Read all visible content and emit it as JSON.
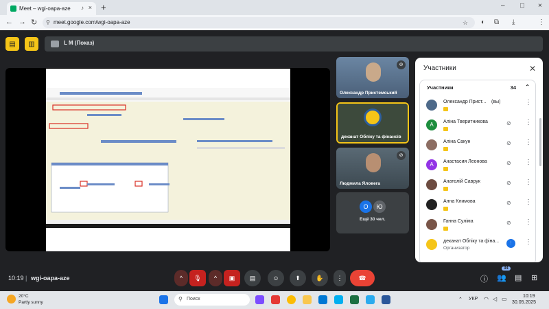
{
  "browser": {
    "tab_title": "Meet – wgi-oapa-aze",
    "url": "meet.google.com/wgi-oapa-aze",
    "new_tab": "+",
    "tab_close": "×",
    "win_min": "–",
    "win_max": "□",
    "win_close": "×"
  },
  "meet": {
    "presenter_label": "L M (Показ)",
    "tiles": [
      {
        "name": "Олександр Пристемський",
        "bg": "#5a7390"
      },
      {
        "name": "деканат Обліку та фінансів",
        "bg": "#3d4a3c"
      },
      {
        "name": "Людмила Яловега",
        "bg": "#4a5a66"
      }
    ],
    "more_tile": {
      "initial_1": "О",
      "initial_2": "Ю",
      "label": "Ещё 30 чел."
    },
    "meeting_time": "10:19",
    "meeting_code": "wgi-oapa-aze",
    "people_count": "34"
  },
  "participants_panel": {
    "title": "Участники",
    "section_label": "Участники",
    "count": "34",
    "list": [
      {
        "name": "Олександр Прист...",
        "suffix": "(вы)",
        "initial": "",
        "avatar_color": "#4e6a8a",
        "role": ""
      },
      {
        "name": "Аліна Тверитникова",
        "suffix": "",
        "initial": "A",
        "avatar_color": "#1e8e3e",
        "role": ""
      },
      {
        "name": "Аліна Сакун",
        "suffix": "",
        "initial": "",
        "avatar_color": "#8d6e63",
        "role": ""
      },
      {
        "name": "Анастасия Леонова",
        "suffix": "",
        "initial": "A",
        "avatar_color": "#9334e6",
        "role": ""
      },
      {
        "name": "Анатолій Саврук",
        "suffix": "",
        "initial": "",
        "avatar_color": "#6d4c41",
        "role": ""
      },
      {
        "name": "Анна Климова",
        "suffix": "",
        "initial": "",
        "avatar_color": "#212121",
        "role": ""
      },
      {
        "name": "Ганна Суліма",
        "suffix": "",
        "initial": "",
        "avatar_color": "#795548",
        "role": ""
      },
      {
        "name": "деканат Обліку та фіна...",
        "suffix": "",
        "initial": "",
        "avatar_color": "#f5c518",
        "role": "Организатор"
      }
    ]
  },
  "taskbar": {
    "temperature": "20°C",
    "weather": "Partly sunny",
    "search_placeholder": "Поиск",
    "language": "УКР",
    "time": "10:19",
    "date": "30.05.2025"
  },
  "colors": {
    "accent_yellow": "#f5c518",
    "end_call_red": "#ea4335",
    "meet_bg": "#202124"
  }
}
